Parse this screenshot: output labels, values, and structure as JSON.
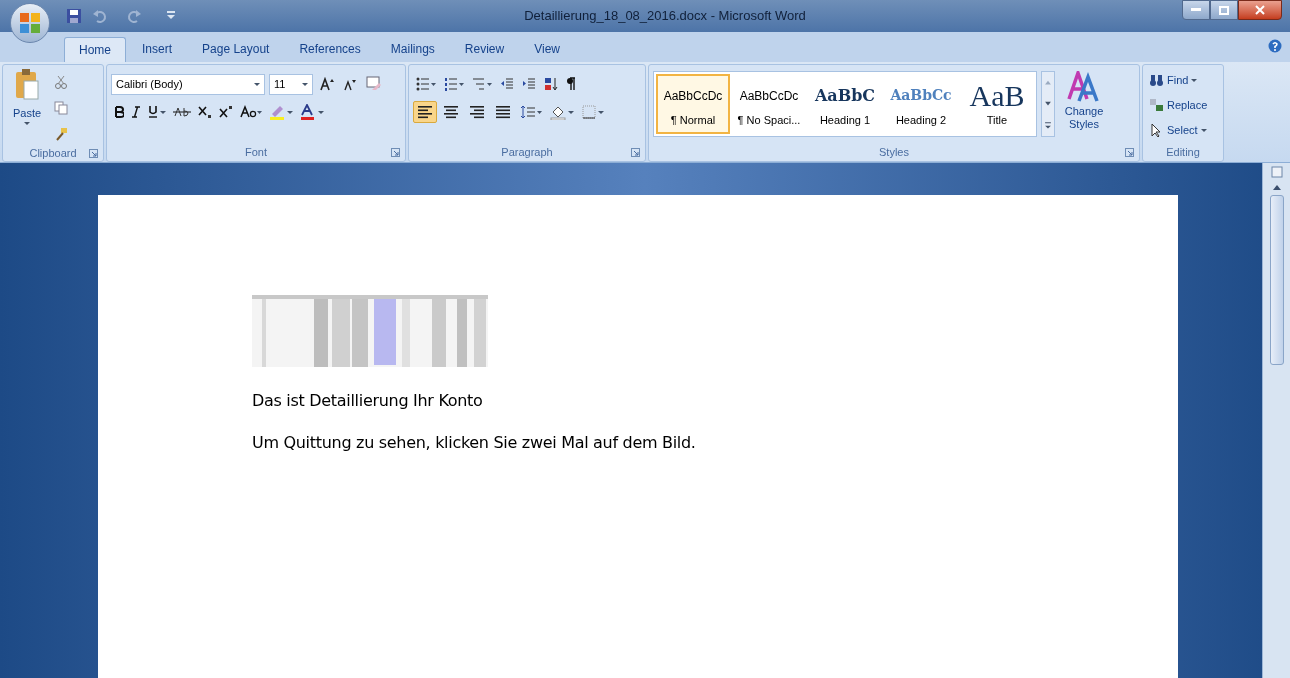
{
  "window": {
    "title": "Detaillierung_18_08_2016.docx - Microsoft Word"
  },
  "tabs": [
    {
      "label": "Home",
      "selected": true
    },
    {
      "label": "Insert",
      "selected": false
    },
    {
      "label": "Page Layout",
      "selected": false
    },
    {
      "label": "References",
      "selected": false
    },
    {
      "label": "Mailings",
      "selected": false
    },
    {
      "label": "Review",
      "selected": false
    },
    {
      "label": "View",
      "selected": false
    }
  ],
  "clipboard": {
    "paste": "Paste",
    "label": "Clipboard"
  },
  "font": {
    "name": "Calibri (Body)",
    "size": "11",
    "label": "Font"
  },
  "paragraph": {
    "label": "Paragraph",
    "alignments": [
      {
        "kind": "left",
        "selected": true
      },
      {
        "kind": "center",
        "selected": false
      },
      {
        "kind": "right",
        "selected": false
      },
      {
        "kind": "justify",
        "selected": false
      }
    ]
  },
  "styles": {
    "label": "Styles",
    "items": [
      {
        "preview": "AaBbCcDc",
        "name": "¶ Normal",
        "kind": "normal",
        "selected": true
      },
      {
        "preview": "AaBbCcDc",
        "name": "¶ No Spaci...",
        "kind": "normal",
        "selected": false
      },
      {
        "preview": "AaBbC",
        "name": "Heading 1",
        "kind": "heading1",
        "selected": false
      },
      {
        "preview": "AaBbCc",
        "name": "Heading 2",
        "kind": "heading2",
        "selected": false
      },
      {
        "preview": "AaB",
        "name": "Title",
        "kind": "title",
        "selected": false
      }
    ],
    "change_styles": "Change Styles"
  },
  "editing": {
    "label": "Editing",
    "items": [
      "Find",
      "Replace",
      "Select"
    ]
  },
  "document": {
    "paragraphs": [
      "Das ist Detaillierung Ihr Konto",
      "Um Quittung zu sehen, klicken Sie zwei Mal auf dem Bild."
    ]
  }
}
